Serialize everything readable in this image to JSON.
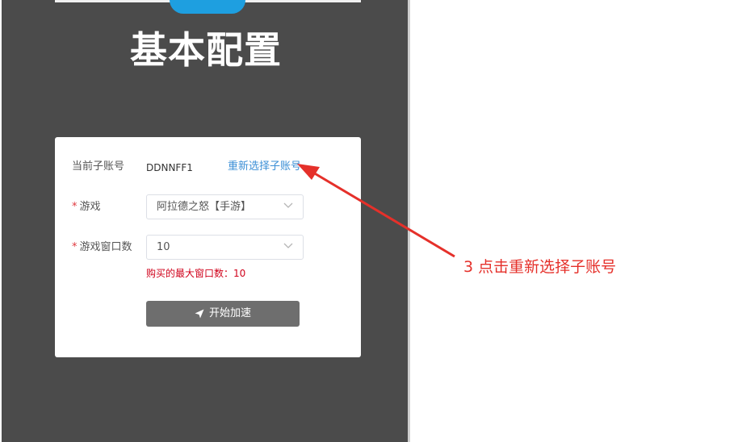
{
  "page": {
    "title": "基本配置"
  },
  "form": {
    "account_label": "当前子账号",
    "account_value": "DDNNFF1",
    "reselect_link": "重新选择子账号",
    "required_mark": "*",
    "game_label": "游戏",
    "game_value": "阿拉德之怒【手游】",
    "window_label": "游戏窗口数",
    "window_value": "10",
    "max_window_hint": "购买的最大窗口数：10",
    "start_button": "开始加速"
  },
  "annotation": {
    "text": "3 点击重新选择子账号"
  },
  "colors": {
    "panel": "#4b4b4b",
    "link": "#3b8fd6",
    "accent_red": "#e5302a",
    "button": "#6e6e6e"
  },
  "icons": {
    "chevron": "chevron-down-icon",
    "send": "paper-plane-icon"
  }
}
